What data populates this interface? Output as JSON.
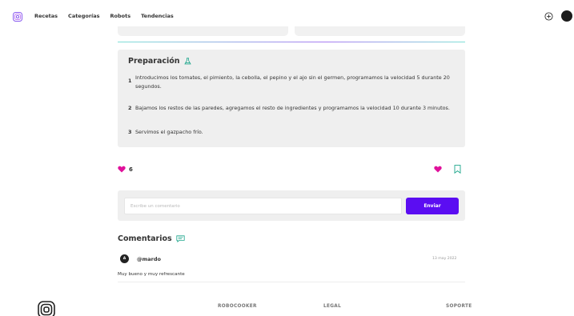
{
  "nav": {
    "items": [
      "Recetas",
      "Categorías",
      "Robots",
      "Tendencias"
    ]
  },
  "preparation": {
    "title": "Preparación",
    "steps": [
      {
        "num": "1",
        "text": "Introducimos los tomates, el pimiento, la cebolla, el pepino y el ajo sin el germen, programamos la velocidad 5 durante 20 segundos."
      },
      {
        "num": "2",
        "text": "Bajamos los restos de las paredes, agregamos el resto de ingredientes y programamos la velocidad 10 durante 3 minutos."
      },
      {
        "num": "3",
        "text": "Servimos el gazpacho frío."
      }
    ]
  },
  "likes": {
    "count": "6"
  },
  "comment_form": {
    "placeholder": "Escribe un comentario",
    "value": "",
    "send_label": "Enviar"
  },
  "comments": {
    "title": "Comentarios",
    "items": [
      {
        "initial": "A",
        "user": "@mardo",
        "date": "13 may 2022",
        "text": "Muy bueno y muy refrescante"
      }
    ]
  },
  "footer": {
    "links": [
      "ROBOCOOKER",
      "LEGAL",
      "SOPORTE"
    ]
  },
  "colors": {
    "accent": "#5b0df2",
    "heart": "#e0119b",
    "bookmark": "#1aa58a",
    "comment_icon": "#1aa58a"
  },
  "icons": {
    "logo": "spiral-logo-icon",
    "add": "plus-circle-icon",
    "preparation": "flask-icon",
    "like": "heart-icon",
    "save": "bookmark-icon",
    "comments": "chat-bubble-icon"
  }
}
